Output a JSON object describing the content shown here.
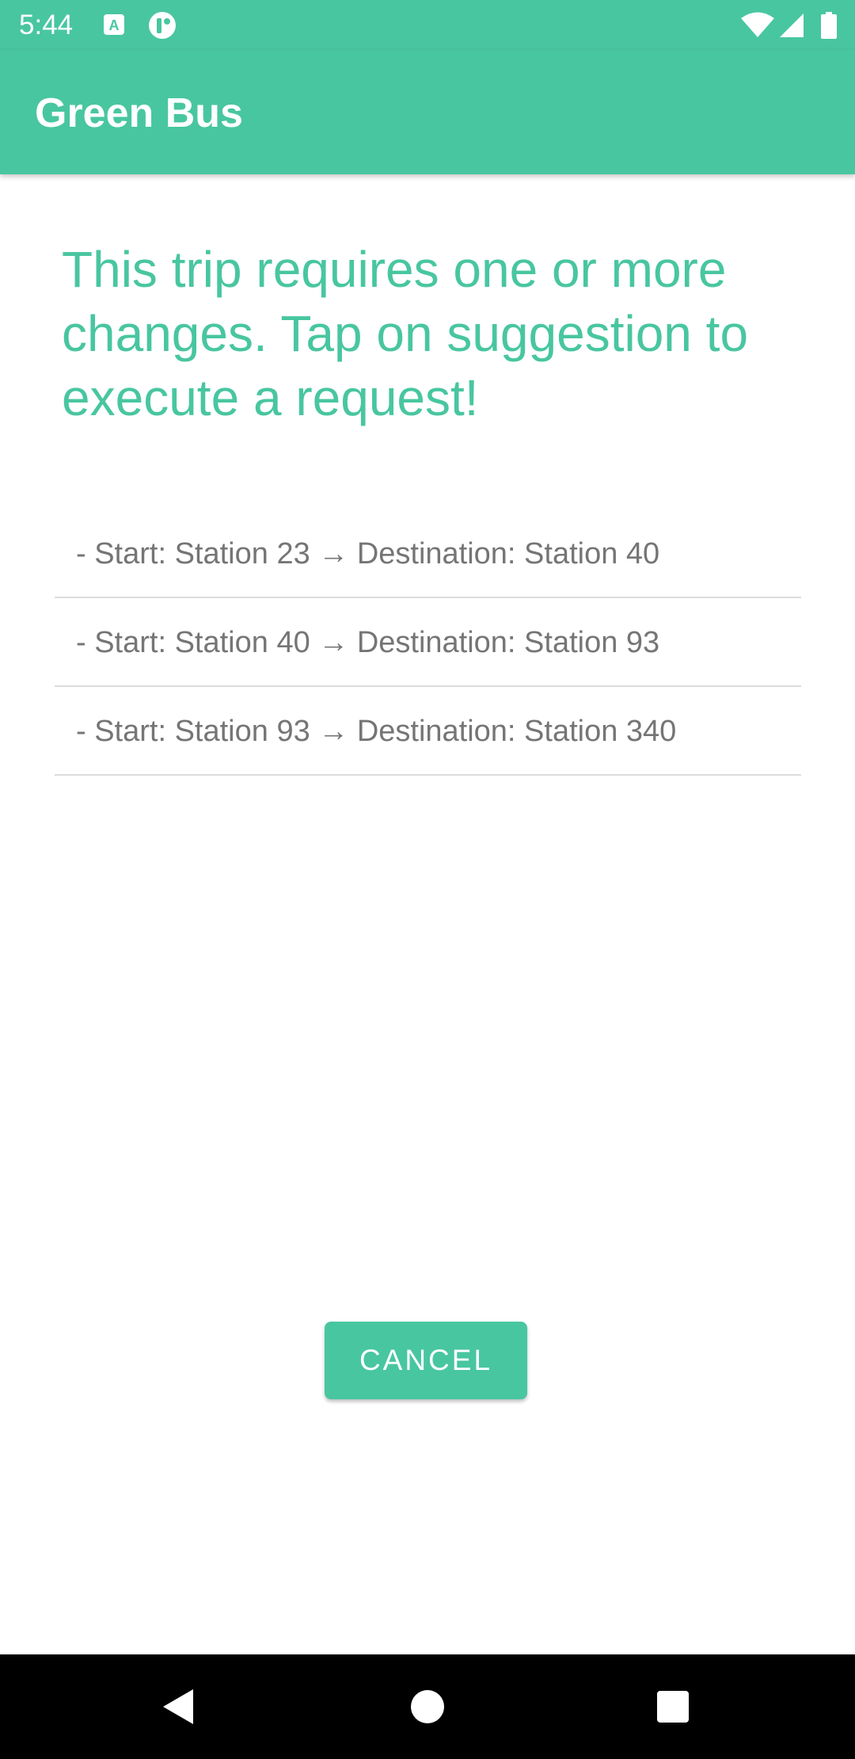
{
  "status_bar": {
    "time": "5:44"
  },
  "app_bar": {
    "title": "Green Bus"
  },
  "main": {
    "heading": "This trip requires one or more changes. Tap on suggestion to execute a request!",
    "trips": [
      {
        "label": "- Start: Station 23 → Destination: Station 40"
      },
      {
        "label": "- Start: Station 40 → Destination: Station 93"
      },
      {
        "label": "- Start: Station 93 → Destination: Station 340"
      }
    ],
    "cancel_label": "CANCEL"
  },
  "colors": {
    "accent": "#48c6a0",
    "text_secondary": "#757575",
    "nav_bar": "#000000"
  },
  "icons": {
    "status_left": [
      "a11y-notification-icon",
      "app-notification-icon"
    ],
    "status_right": [
      "wifi-icon",
      "signal-icon",
      "battery-icon"
    ],
    "navigation": [
      "back-icon",
      "home-icon",
      "recents-icon"
    ]
  }
}
